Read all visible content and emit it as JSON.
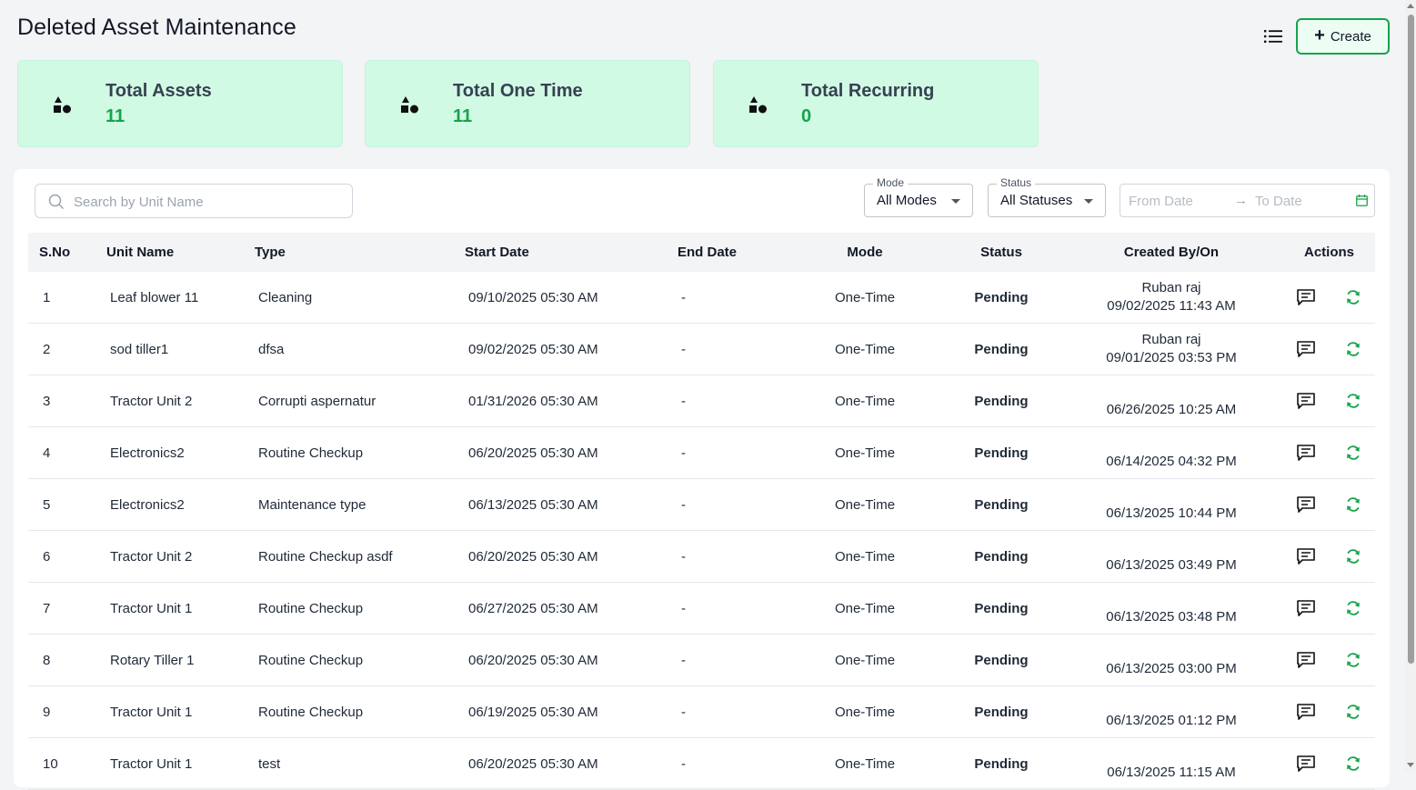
{
  "page": {
    "title": "Deleted Asset Maintenance",
    "create_label": "Create"
  },
  "stats": [
    {
      "label": "Total Assets",
      "value": "11"
    },
    {
      "label": "Total One Time",
      "value": "11"
    },
    {
      "label": "Total Recurring",
      "value": "0"
    }
  ],
  "filters": {
    "search_placeholder": "Search by Unit Name",
    "mode_label": "Mode",
    "mode_value": "All Modes",
    "status_label": "Status",
    "status_value": "All Statuses",
    "from_placeholder": "From Date",
    "to_placeholder": "To Date"
  },
  "table": {
    "headers": {
      "sno": "S.No",
      "unit_name": "Unit Name",
      "type": "Type",
      "start_date": "Start Date",
      "end_date": "End Date",
      "mode": "Mode",
      "status": "Status",
      "created": "Created By/On",
      "actions": "Actions"
    },
    "rows": [
      {
        "sno": "1",
        "unit_name": "Leaf blower 11",
        "type": "Cleaning",
        "start_date": "09/10/2025 05:30 AM",
        "end_date": "-",
        "mode": "One-Time",
        "status": "Pending",
        "created_by": "Ruban raj",
        "created_on": "09/02/2025 11:43 AM"
      },
      {
        "sno": "2",
        "unit_name": "sod tiller1",
        "type": "dfsa",
        "start_date": "09/02/2025 05:30 AM",
        "end_date": "-",
        "mode": "One-Time",
        "status": "Pending",
        "created_by": "Ruban raj",
        "created_on": "09/01/2025 03:53 PM"
      },
      {
        "sno": "3",
        "unit_name": "Tractor Unit 2",
        "type": "Corrupti aspernatur",
        "start_date": "01/31/2026 05:30 AM",
        "end_date": "-",
        "mode": "One-Time",
        "status": "Pending",
        "created_by": "",
        "created_on": "06/26/2025 10:25 AM"
      },
      {
        "sno": "4",
        "unit_name": "Electronics2",
        "type": "Routine Checkup",
        "start_date": "06/20/2025 05:30 AM",
        "end_date": "-",
        "mode": "One-Time",
        "status": "Pending",
        "created_by": "",
        "created_on": "06/14/2025 04:32 PM"
      },
      {
        "sno": "5",
        "unit_name": "Electronics2",
        "type": "Maintenance type",
        "start_date": "06/13/2025 05:30 AM",
        "end_date": "-",
        "mode": "One-Time",
        "status": "Pending",
        "created_by": "",
        "created_on": "06/13/2025 10:44 PM"
      },
      {
        "sno": "6",
        "unit_name": "Tractor Unit 2",
        "type": "Routine Checkup asdf",
        "start_date": "06/20/2025 05:30 AM",
        "end_date": "-",
        "mode": "One-Time",
        "status": "Pending",
        "created_by": "",
        "created_on": "06/13/2025 03:49 PM"
      },
      {
        "sno": "7",
        "unit_name": "Tractor Unit 1",
        "type": "Routine Checkup",
        "start_date": "06/27/2025 05:30 AM",
        "end_date": "-",
        "mode": "One-Time",
        "status": "Pending",
        "created_by": "",
        "created_on": "06/13/2025 03:48 PM"
      },
      {
        "sno": "8",
        "unit_name": "Rotary Tiller 1",
        "type": "Routine Checkup",
        "start_date": "06/20/2025 05:30 AM",
        "end_date": "-",
        "mode": "One-Time",
        "status": "Pending",
        "created_by": "",
        "created_on": "06/13/2025 03:00 PM"
      },
      {
        "sno": "9",
        "unit_name": "Tractor Unit 1",
        "type": "Routine Checkup",
        "start_date": "06/19/2025 05:30 AM",
        "end_date": "-",
        "mode": "One-Time",
        "status": "Pending",
        "created_by": "",
        "created_on": "06/13/2025 01:12 PM"
      },
      {
        "sno": "10",
        "unit_name": "Tractor Unit 1",
        "type": "test",
        "start_date": "06/20/2025 05:30 AM",
        "end_date": "-",
        "mode": "One-Time",
        "status": "Pending",
        "created_by": "",
        "created_on": "06/13/2025 11:15 AM"
      }
    ]
  },
  "icons": {
    "stat": "shapes-icon",
    "list_view": "list-view-icon",
    "search": "search-icon",
    "calendar": "calendar-icon",
    "comment": "comment-icon",
    "restore": "restore-icon"
  },
  "colors": {
    "accent": "#16a34a",
    "card_bg": "#d1fae5",
    "pending": "#d4a017"
  }
}
